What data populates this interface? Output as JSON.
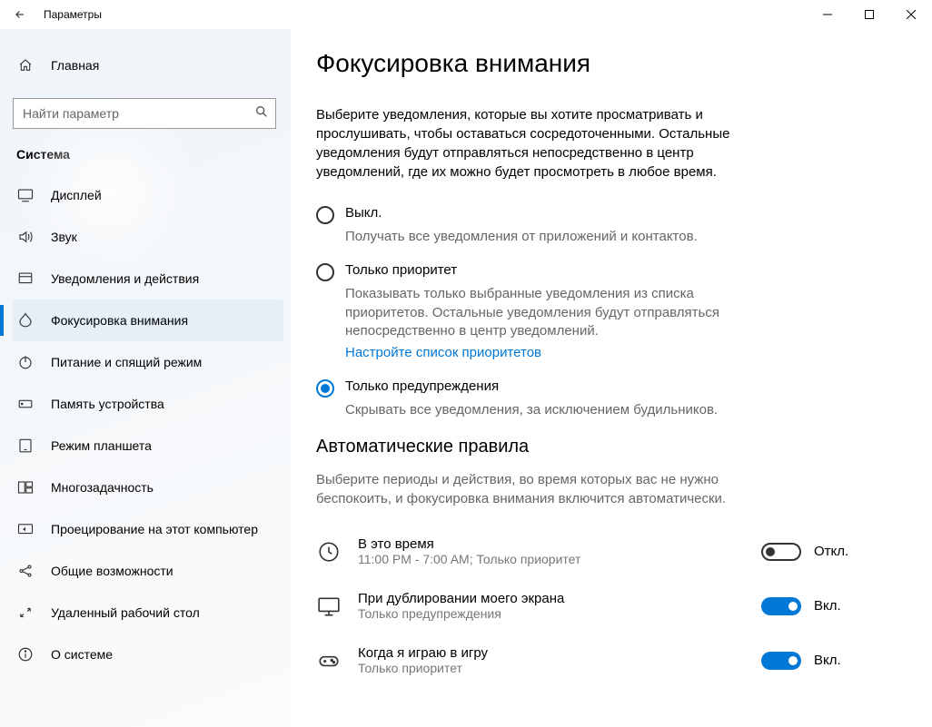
{
  "window": {
    "title": "Параметры"
  },
  "sidebar": {
    "home": "Главная",
    "search_placeholder": "Найти параметр",
    "group": "Система",
    "items": [
      {
        "label": "Дисплей"
      },
      {
        "label": "Звук"
      },
      {
        "label": "Уведомления и действия"
      },
      {
        "label": "Фокусировка внимания"
      },
      {
        "label": "Питание и спящий режим"
      },
      {
        "label": "Память устройства"
      },
      {
        "label": "Режим планшета"
      },
      {
        "label": "Многозадачность"
      },
      {
        "label": "Проецирование на этот компьютер"
      },
      {
        "label": "Общие возможности"
      },
      {
        "label": "Удаленный рабочий стол"
      },
      {
        "label": "О системе"
      }
    ]
  },
  "main": {
    "title": "Фокусировка внимания",
    "intro": "Выберите уведомления, которые вы хотите просматривать и прослушивать, чтобы оставаться сосредоточенными. Остальные уведомления будут отправляться непосредственно в центр уведомлений, где их можно будет просмотреть в любое время.",
    "radios": {
      "off": {
        "label": "Выкл.",
        "sub": "Получать все уведомления от приложений и контактов."
      },
      "priority": {
        "label": "Только приоритет",
        "sub": "Показывать только выбранные уведомления из списка приоритетов. Остальные уведомления будут отправляться непосредственно в центр уведомлений.",
        "link": "Настройте список приоритетов"
      },
      "alarms": {
        "label": "Только предупреждения",
        "sub": "Скрывать все уведомления, за исключением будильников."
      }
    },
    "auto": {
      "heading": "Автоматические правила",
      "desc": "Выберите периоды и действия, во время которых вас не нужно беспокоить, и фокусировка внимания включится автоматически.",
      "rules": {
        "time": {
          "title": "В это время",
          "sub": "11:00 PM - 7:00 AM; Только приоритет",
          "state": "Откл."
        },
        "dup": {
          "title": "При дублировании моего экрана",
          "sub": "Только предупреждения",
          "state": "Вкл."
        },
        "game": {
          "title": "Когда я играю в игру",
          "sub": "Только приоритет",
          "state": "Вкл."
        }
      }
    }
  }
}
